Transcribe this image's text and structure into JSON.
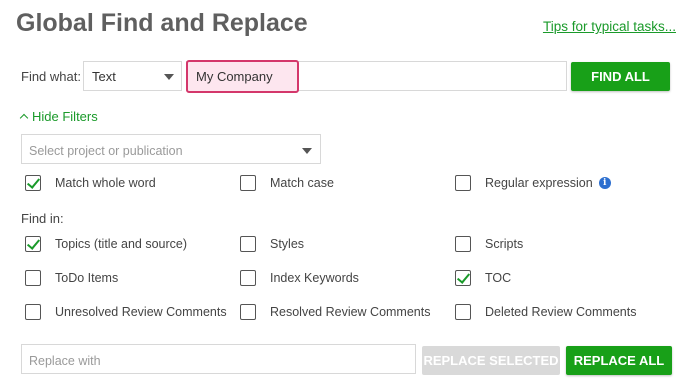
{
  "header": {
    "title": "Global Find and Replace",
    "tips_link": "Tips for typical tasks..."
  },
  "find": {
    "label": "Find what:",
    "type_select": "Text",
    "query": "My Company",
    "find_all_button": "FIND ALL"
  },
  "filters": {
    "toggle_label": "Hide Filters",
    "project_placeholder": "Select project or publication",
    "options": [
      {
        "label": "Match whole word",
        "checked": true
      },
      {
        "label": "Match case",
        "checked": false
      },
      {
        "label": "Regular expression",
        "checked": false
      }
    ]
  },
  "find_in": {
    "label": "Find in:",
    "items": [
      {
        "label": "Topics (title and source)",
        "checked": true
      },
      {
        "label": "Styles",
        "checked": false
      },
      {
        "label": "Scripts",
        "checked": false
      },
      {
        "label": "ToDo Items",
        "checked": false
      },
      {
        "label": "Index Keywords",
        "checked": false
      },
      {
        "label": "TOC",
        "checked": true
      },
      {
        "label": "Unresolved Review Comments",
        "checked": false
      },
      {
        "label": "Resolved Review Comments",
        "checked": false
      },
      {
        "label": "Deleted Review Comments",
        "checked": false
      }
    ]
  },
  "replace": {
    "placeholder": "Replace with",
    "replace_selected_button": "REPLACE SELECTED",
    "replace_all_button": "REPLACE ALL"
  },
  "colors": {
    "accent_green": "#18a018",
    "highlight_border": "#d4376b",
    "highlight_fill": "#fde6ef",
    "info_blue": "#2d6fcf"
  },
  "icons": {
    "info": "info-icon",
    "dropdown": "chevron-down-icon",
    "collapse": "chevron-up-icon",
    "check": "check-icon"
  }
}
